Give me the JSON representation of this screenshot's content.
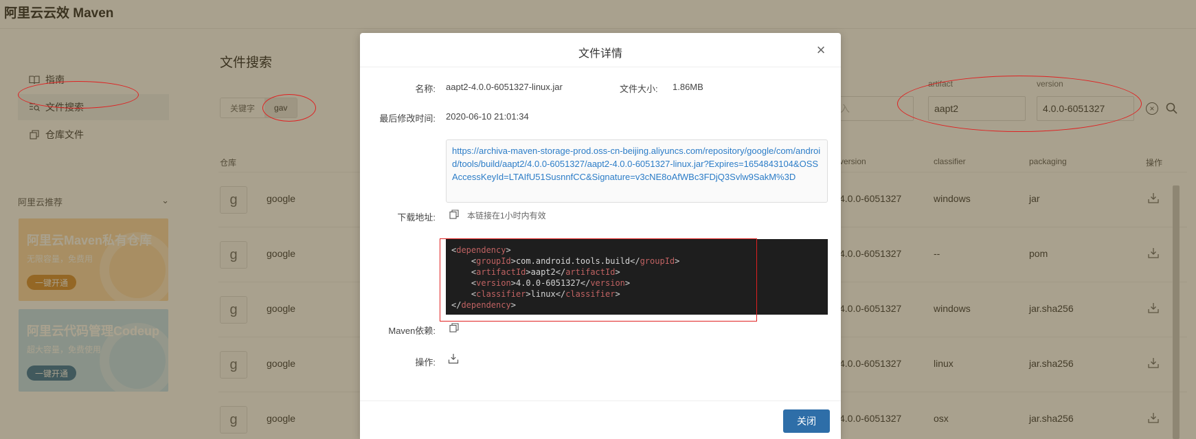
{
  "app": {
    "title": "阿里云云效 Maven"
  },
  "sidebar": {
    "items": [
      {
        "label": "指南"
      },
      {
        "label": "文件搜索"
      },
      {
        "label": "仓库文件"
      }
    ],
    "recommend_label": "阿里云推荐",
    "promos": [
      {
        "title": "阿里云Maven私有仓库",
        "subtitle": "无限容量，免费用",
        "button": "一键开通"
      },
      {
        "title": "阿里云代码管理Codeup",
        "subtitle": "超大容量，免费使用",
        "button": "一键开通"
      }
    ]
  },
  "main": {
    "title": "文件搜索",
    "search_tabs": [
      {
        "label": "关键字"
      },
      {
        "label": "gav"
      }
    ],
    "fields": {
      "group_placeholder": "输入",
      "artifact_label": "artifact",
      "artifact_value": "aapt2",
      "version_label": "version",
      "version_value": "4.0.0-6051327"
    },
    "table": {
      "headers": {
        "repo": "仓库",
        "version": "version",
        "classifier": "classifier",
        "packaging": "packaging",
        "ops": "操作"
      },
      "rows": [
        {
          "icon": "g",
          "repo": "google",
          "version": "4.0.0-6051327",
          "classifier": "windows",
          "packaging": "jar"
        },
        {
          "icon": "g",
          "repo": "google",
          "version": "4.0.0-6051327",
          "classifier": "--",
          "packaging": "pom"
        },
        {
          "icon": "g",
          "repo": "google",
          "version": "4.0.0-6051327",
          "classifier": "windows",
          "packaging": "jar.sha256"
        },
        {
          "icon": "g",
          "repo": "google",
          "version": "4.0.0-6051327",
          "classifier": "linux",
          "packaging": "jar.sha256"
        },
        {
          "icon": "g",
          "repo": "google",
          "version": "4.0.0-6051327",
          "classifier": "osx",
          "packaging": "jar.sha256"
        }
      ]
    }
  },
  "modal": {
    "title": "文件详情",
    "name_label": "名称:",
    "name_value": "aapt2-4.0.0-6051327-linux.jar",
    "size_label": "文件大小:",
    "size_value": "1.86MB",
    "modified_label": "最后修改时间:",
    "modified_value": "2020-06-10 21:01:34",
    "download_label": "下载地址:",
    "download_url": "https://archiva-maven-storage-prod.oss-cn-beijing.aliyuncs.com/repository/google/com/android/tools/build/aapt2/4.0.0-6051327/aapt2-4.0.0-6051327-linux.jar?Expires=1654843104&OSSAccessKeyId=LTAIfU51SusnnfCC&Signature=v3cNE8oAfWBc3FDjQ3Svlw9SakM%3D",
    "link_hint": "本链接在1小时内有效",
    "maven_label": "Maven依赖:",
    "ops_label": "操作:",
    "close_button": "关闭",
    "dependency": {
      "groupId": "com.android.tools.build",
      "artifactId": "aapt2",
      "version": "4.0.0-6051327",
      "classifier": "linux"
    }
  },
  "colors": {
    "primary": "#2e6ea8",
    "annotation": "#e02020",
    "code_bg": "#1e1e1e",
    "code_tag": "#c06262"
  }
}
